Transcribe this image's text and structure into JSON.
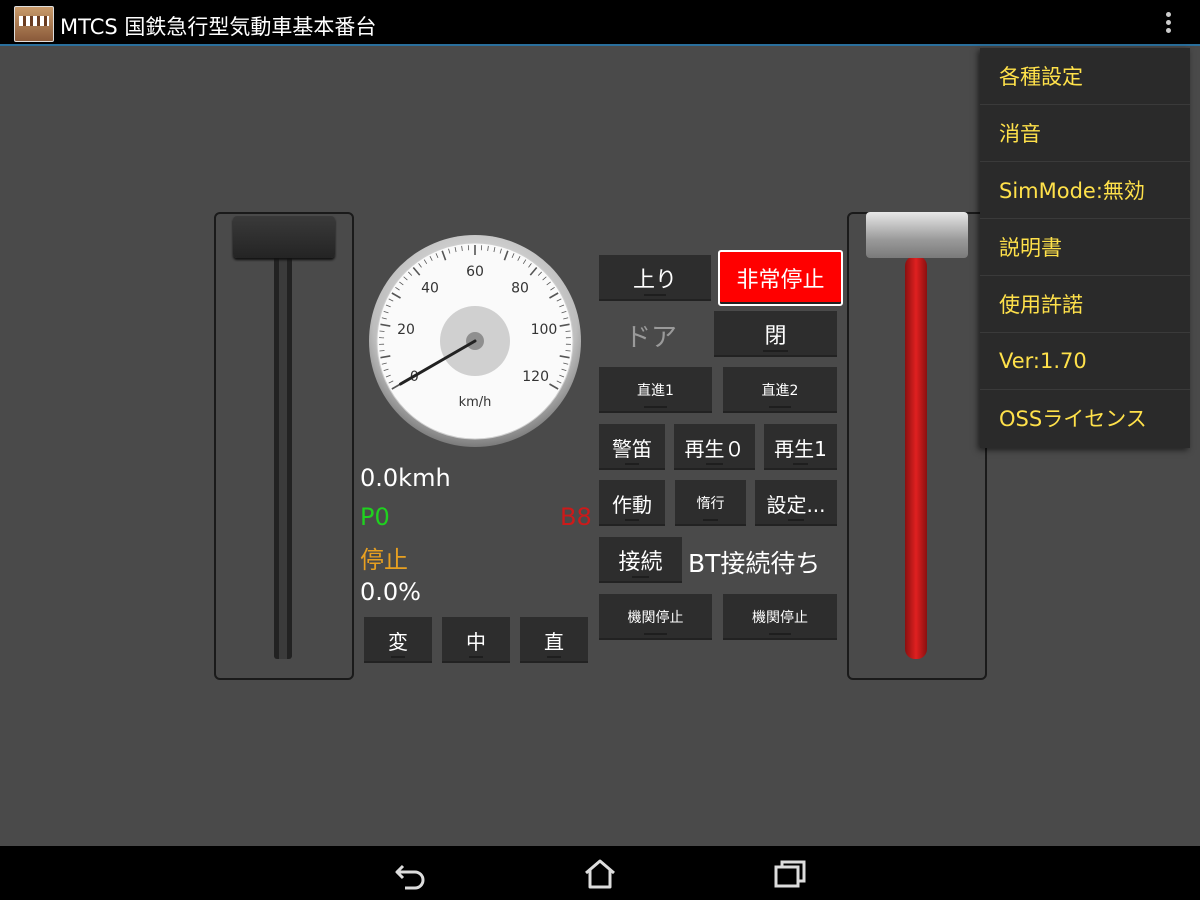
{
  "app": {
    "title": "MTCS 国鉄急行型気動車基本番台"
  },
  "gauge": {
    "unit": "km/h",
    "ticks": [
      "0",
      "20",
      "40",
      "60",
      "80",
      "100",
      "120"
    ],
    "max": 120,
    "needle_value": 0
  },
  "readouts": {
    "speed": "0.0kmh",
    "power_notch": "P0",
    "brake_notch": "B8",
    "status": "停止",
    "percent": "0.0%"
  },
  "reverser": {
    "buttons": [
      "変",
      "中",
      "直"
    ]
  },
  "controls": {
    "direction": "上り",
    "emergency": "非常停止",
    "door_label": "ドア",
    "door_state": "閉",
    "direct1": "直進1",
    "direct2": "直進2",
    "horn": "警笛",
    "play0": "再生０",
    "play1": "再生1",
    "action": "作動",
    "coast": "惰行",
    "settings": "設定...",
    "connect": "接続",
    "bt_status": "BT接続待ち",
    "engine_stop1": "機関停止",
    "engine_stop2": "機関停止"
  },
  "menu": {
    "items": [
      "各種設定",
      "消音",
      "SimMode:無効",
      "説明書",
      "使用許諾",
      "Ver:1.70",
      "OSSライセンス"
    ]
  },
  "colors": {
    "background": "#4a4a4a",
    "emergency": "#ff0000",
    "menu_text": "#ffe14a",
    "power": "#1fd11f",
    "brake": "#cc1a1a",
    "status": "#e8a020"
  }
}
